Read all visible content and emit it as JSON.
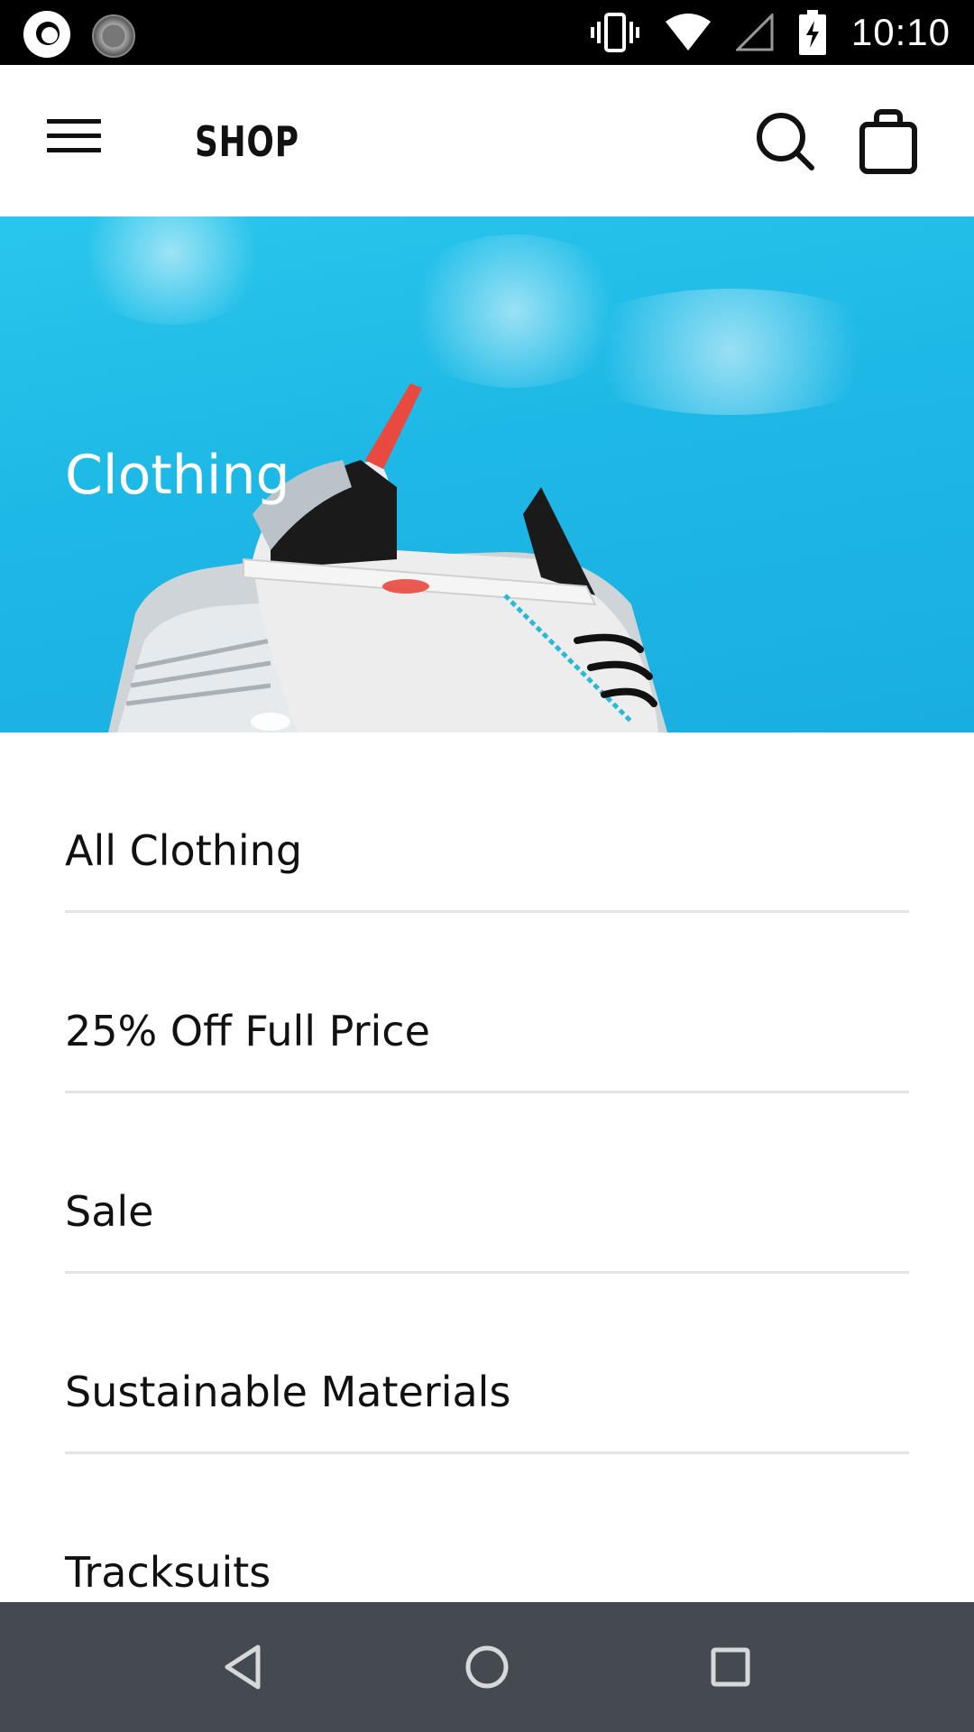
{
  "status_bar": {
    "time": "10:10",
    "icons": [
      "app-notification-icon",
      "loading-icon",
      "vibrate-icon",
      "wifi-icon",
      "signal-icon",
      "battery-charging-icon"
    ]
  },
  "app_bar": {
    "title": "SHOP",
    "icons": [
      "menu-icon",
      "search-icon",
      "shopping-bag-icon"
    ]
  },
  "hero": {
    "title": "Clothing",
    "background_color": "#1eb8e6"
  },
  "categories": [
    {
      "label": "All Clothing"
    },
    {
      "label": "25% Off Full Price"
    },
    {
      "label": "Sale"
    },
    {
      "label": "Sustainable Materials"
    },
    {
      "label": "Tracksuits"
    }
  ],
  "nav_bar": {
    "icons": [
      "back-icon",
      "home-icon",
      "recents-icon"
    ]
  }
}
